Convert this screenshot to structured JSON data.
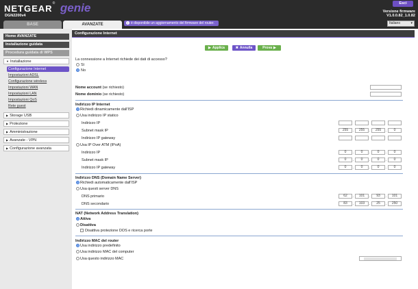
{
  "header": {
    "brand": "NETGEAR",
    "product": "genie",
    "model": "DGN2200v4",
    "logout_label": "Esci",
    "firmware_title": "Versione firmware",
    "firmware_version": "V1.0.0.82_1.0.82",
    "language": "Italiano"
  },
  "tabs": {
    "basic": "BASE",
    "advanced": "AVANZATE"
  },
  "notice": "è disponibile un aggiornamento del firmware del router.",
  "sidebar": {
    "home": "Home AVANZATE",
    "setup_wizard": "Installazione guidata",
    "wps_wizard": "Procedura guidata di WPS",
    "setup_group": "Installazione",
    "setup_items": [
      "Configurazione Internet",
      "Impostazioni ADSL",
      "Configurazione wireless",
      "Impostazioni WAN",
      "Impostazioni LAN",
      "Impostazioni QoS",
      "Rete guest"
    ],
    "groups": [
      "Storage USB",
      "Protezione",
      "Amministrazione",
      "Avanzate - VPN",
      "Configurazione avanzata"
    ]
  },
  "page": {
    "title": "Configurazione Internet",
    "buttons": {
      "apply": "Applica",
      "cancel": "Annulla",
      "test": "Prova"
    },
    "login_question": "La connessione a Internet richiede dei dati di accesso?",
    "login_yes": "Sì",
    "login_no": "No",
    "account_name_label": "Nome account",
    "account_name_hint": "(se richiesto)",
    "domain_name_label": "Nome dominio",
    "domain_name_hint": "(se richiesto)",
    "ip_section": "Indirizzo IP Internet",
    "ip_dynamic": "Richiedi dinamicamente dall'ISP",
    "ip_static": "Usa indirizzo IP statico",
    "ip_static_fields": {
      "ip_label": "Indirizzo IP",
      "mask_label": "Subnet mask IP",
      "gateway_label": "Indirizzo IP gateway",
      "mask_values": [
        "255",
        "255",
        "255",
        "0"
      ]
    },
    "ip_over_atm": "Usa IP Over ATM (IPoA)",
    "ipoa_fields": {
      "ip_label": "Indirizzo IP",
      "mask_label": "Subnet mask IP",
      "gateway_label": "Indirizzo IP gateway",
      "zero": "0"
    },
    "dns_section": "Indirizzo DNS (Domain Name Server)",
    "dns_auto": "Richiedi automaticamente dall'ISP",
    "dns_manual": "Usa questi server DNS",
    "dns_primary_label": "DNS primario",
    "dns_primary": [
      "62",
      "101",
      "93",
      "101"
    ],
    "dns_secondary_label": "DNS secondario",
    "dns_secondary": [
      "83",
      "103",
      "25",
      "250"
    ],
    "nat_section": "NAT (Network Address Translation)",
    "nat_enable": "Attiva",
    "nat_disable": "Disattiva",
    "nat_dos": "Disattiva protezione DOS e ricerca porte",
    "mac_section": "Indirizzo MAC del router",
    "mac_default": "Usa indirizzo predefinito",
    "mac_computer": "Usa indirizzo MAC del computer",
    "mac_custom": "Usa questo indirizzo MAC"
  }
}
